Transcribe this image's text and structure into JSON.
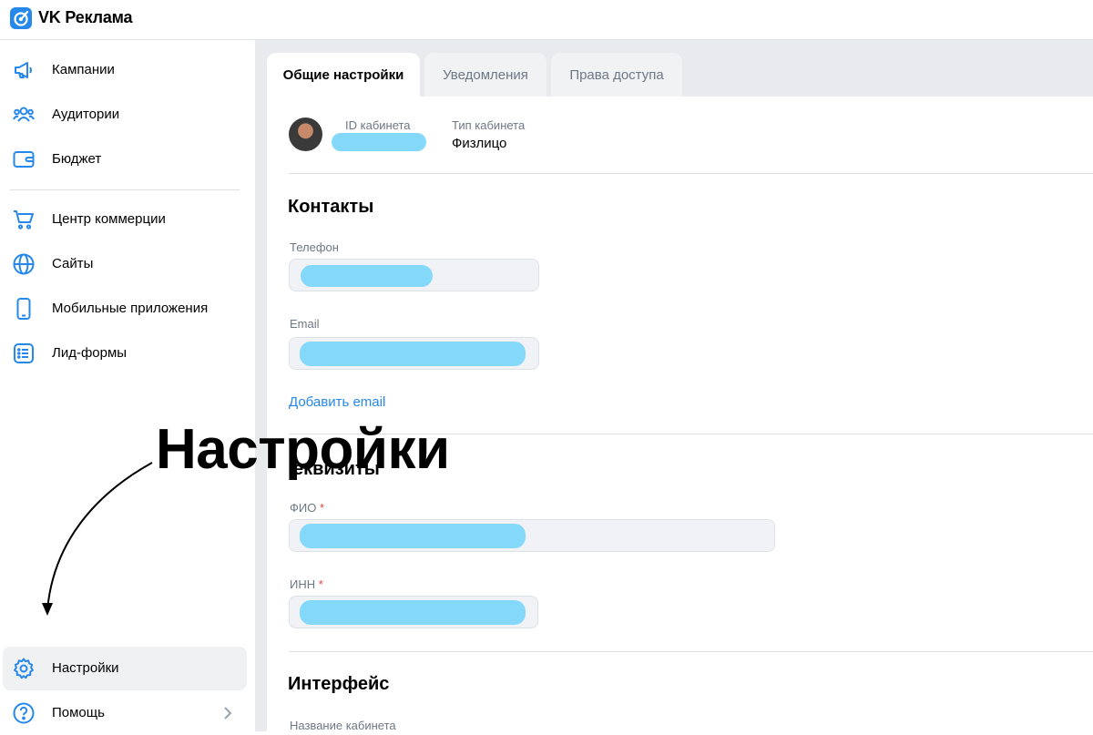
{
  "app": {
    "title": "VK Реклама",
    "logo_icon": "vk-ads-logo-icon",
    "accent": "#2688eb"
  },
  "sidebar": {
    "items": [
      {
        "label": "Кампании",
        "icon": "megaphone-icon"
      },
      {
        "label": "Аудитории",
        "icon": "users-icon"
      },
      {
        "label": "Бюджет",
        "icon": "wallet-icon"
      },
      {
        "label": "Центр коммерции",
        "icon": "cart-icon"
      },
      {
        "label": "Сайты",
        "icon": "globe-icon"
      },
      {
        "label": "Мобильные приложения",
        "icon": "phone-icon"
      },
      {
        "label": "Лид-формы",
        "icon": "list-form-icon"
      }
    ],
    "bottom": [
      {
        "label": "Настройки",
        "icon": "gear-icon",
        "active": true
      },
      {
        "label": "Помощь",
        "icon": "question-icon",
        "chevron": true
      }
    ]
  },
  "tabs": [
    {
      "label": "Общие настройки",
      "active": true
    },
    {
      "label": "Уведомления",
      "active": false
    },
    {
      "label": "Права доступа",
      "active": false
    }
  ],
  "account": {
    "id_label": "ID кабинета",
    "type_label": "Тип кабинета",
    "type_value": "Физлицо"
  },
  "contacts": {
    "title": "Контакты",
    "phone_label": "Телефон",
    "email_label": "Email",
    "add_email": "Добавить email"
  },
  "requisites": {
    "title": "еквизиты",
    "fio_label": "ФИО",
    "inn_label": "ИНН",
    "required_mark": "*"
  },
  "interface": {
    "title": "Интерфейс",
    "cabinet_name_label": "Название кабинета"
  },
  "annotation": {
    "text": "Настройки"
  },
  "colors": {
    "redaction": "#84d9fb",
    "required": "#e64646",
    "link": "#2688eb"
  }
}
